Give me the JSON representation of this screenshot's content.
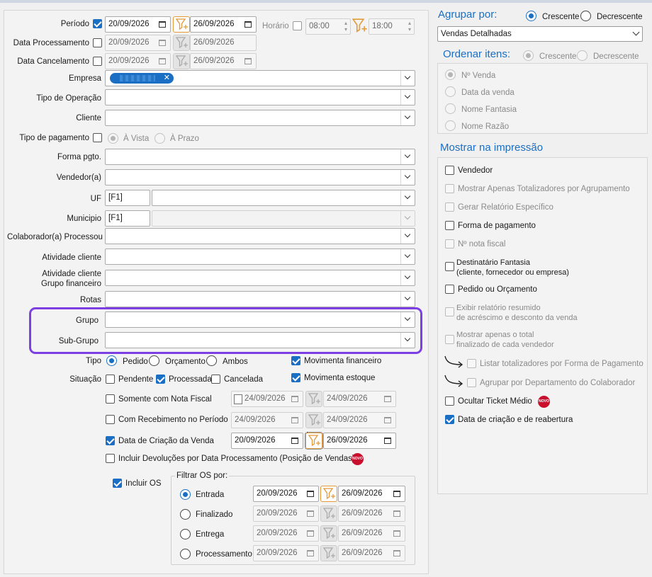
{
  "left": {
    "periodo_label": "Período",
    "data_proc_label": "Data Processamento",
    "data_canc_label": "Data Cancelamento",
    "periodo_inicio": "20/09/2026",
    "periodo_fim": "26/09/2026",
    "horario_label": "Horário",
    "horario_inicio": "08:00",
    "horario_fim": "18:00",
    "dp_inicio": "20/09/2026",
    "dp_fim": "26/09/2026",
    "dc_inicio": "20/09/2026",
    "dc_fim": "26/09/2026",
    "empresa_label": "Empresa",
    "tipo_operacao_label": "Tipo de Operação",
    "cliente_label": "Cliente",
    "tipo_pagamento_label": "Tipo de pagamento",
    "a_vista": "À Vista",
    "a_prazo": "À Prazo",
    "forma_pgto_label": "Forma pgto.",
    "vendedor_label": "Vendedor(a)",
    "uf_label": "UF",
    "uf_code": "[F1]",
    "municipio_label": "Municipio",
    "municipio_code": "[F1]",
    "colaborador_label": "Colaborador(a) Processou",
    "atividade_label": "Atividade cliente",
    "atividade_grupo_label_1": "Atividade cliente",
    "atividade_grupo_label_2": "Grupo financeiro",
    "rotas_label": "Rotas",
    "grupo_label": "Grupo",
    "subgrupo_label": "Sub-Grupo",
    "tipo_label": "Tipo",
    "tipo_pedido": "Pedido",
    "tipo_orcamento": "Orçamento",
    "tipo_ambos": "Ambos",
    "movimenta_financeiro": "Movimenta financeiro",
    "situacao_label": "Situação",
    "sit_pendente": "Pendente",
    "sit_processada": "Processada",
    "sit_cancelada": "Cancelada",
    "movimenta_estoque": "Movimenta estoque",
    "somente_nf": "Somente com Nota Fiscal",
    "snf_inicio": "24/09/2026",
    "snf_fim": "24/09/2026",
    "com_receb": "Com Recebimento no Período",
    "cr_inicio": "24/09/2026",
    "cr_fim": "24/09/2026",
    "data_criacao": "Data de Criação da Venda",
    "dcv_inicio": "20/09/2026",
    "dcv_fim": "26/09/2026",
    "incluir_devolucoes": "Incluir Devoluções por Data Processamento (Posição de Vendas)",
    "novo_badge": "NOVO",
    "incluir_os": "Incluir OS",
    "filtrar_os": "Filtrar OS por:",
    "os_entrada": "Entrada",
    "os_finalizado": "Finalizado",
    "os_entrega": "Entrega",
    "os_processamento": "Processamento",
    "os_dates": [
      {
        "inicio": "20/09/2026",
        "fim": "26/09/2026"
      },
      {
        "inicio": "20/09/2026",
        "fim": "26/09/2026"
      },
      {
        "inicio": "20/09/2026",
        "fim": "26/09/2026"
      },
      {
        "inicio": "20/09/2026",
        "fim": "26/09/2026"
      }
    ]
  },
  "right": {
    "agrupar_label": "Agrupar por:",
    "crescente": "Crescente",
    "decrescente": "Decrescente",
    "agrupar_value": "Vendas Detalhadas",
    "ordenar_label": "Ordenar itens:",
    "ord_crescente": "Crescente",
    "ord_decrescente": "Decrescente",
    "ord_items": [
      "Nº Venda",
      "Data da venda",
      "Nome Fantasia",
      "Nome Razão"
    ],
    "mostrar_label": "Mostrar na impressão",
    "vendedor": "Vendedor",
    "mostrar_apenas_tot": "Mostrar Apenas Totalizadores por Agrupamento",
    "gerar_relatorio": "Gerar Relatório Específico",
    "forma_pagamento": "Forma de pagamento",
    "nota_fiscal": "Nº nota fiscal",
    "destinatario_1": "Destinatário Fantasia",
    "destinatario_2": "(cliente, fornecedor ou empresa)",
    "pedido_orcamento": "Pedido ou Orçamento",
    "exibir_resumido_1": "Exibir relatório resumido",
    "exibir_resumido_2": "de acréscimo e desconto da venda",
    "mostrar_total_1": "Mostrar apenas o total",
    "mostrar_total_2": "finalizado de cada vendedor",
    "listar_totalizadores": "Listar totalizadores por Forma de Pagamento",
    "agrupar_departamento": "Agrupar por Departamento do Colaborador",
    "ocultar_ticket": "Ocultar Ticket Médio",
    "novo_badge": "NOVO",
    "data_criacao_reabertura": "Data de criação e de reabertura"
  },
  "colors": {
    "accent": "#1a6fc4",
    "highlight": "#7b3fe4",
    "filter": "#e39a3a",
    "badge": "#c8102e"
  }
}
